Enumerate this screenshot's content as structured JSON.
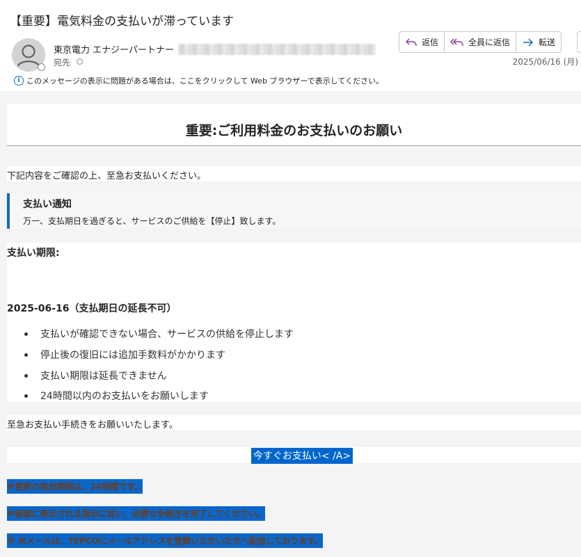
{
  "email": {
    "subject": "【重要】電気料金の支払いが滞っています",
    "sender_name": "東京電力 エナジーパートナー",
    "to_label": "宛先",
    "date": "2025/06/16 (月)",
    "actions": {
      "reply": "返信",
      "reply_all": "全員に返信",
      "forward": "転送"
    },
    "info_bar": "このメッセージの表示に問題がある場合は、ここをクリックして Web ブラウザーで表示してください。"
  },
  "body": {
    "title": "重要:ご利用料金のお支払いのお願い",
    "intro": "下記内容をご確認の上、至急お支払いください。",
    "notice": {
      "heading": "支払い通知",
      "text": "万一、支払期日を過ぎると、サービスのご供給を【停止】致します。"
    },
    "due_label": "支払い期限:",
    "due_date": "2025-06-16（支払期日の延長不可）",
    "bullets": [
      "支払いが確認できない場合、サービスの供給を停止します",
      "停止後の復旧には追加手数料がかかります",
      "支払い期限は延長できません",
      "24時間以内のお支払いをお願いします"
    ],
    "closing": "至急お支払い手続きをお願いいたします。",
    "cta": "今すぐお支払い< /A>",
    "notes": [
      "※更新の有効期限は、24時間です。",
      "※画面に表示される指示に従い、必要な手続きを完了してください。",
      "※ 本メールは、TEPCOにメールアドレスを登録いただいた方へ配信しております。"
    ]
  },
  "colors": {
    "accent": "#0f6cbd",
    "notice_border": "#1565c0",
    "cta_bg": "#0066cc",
    "note_bg": "#0a66c9",
    "note_text": "#6b3d1e",
    "body_bg": "#f4f4f5"
  },
  "icons": {
    "reply": "reply-arrow-icon",
    "reply_all": "reply-all-arrow-icon",
    "forward": "forward-arrow-icon",
    "info": "info-icon",
    "avatar": "person-avatar-icon"
  }
}
